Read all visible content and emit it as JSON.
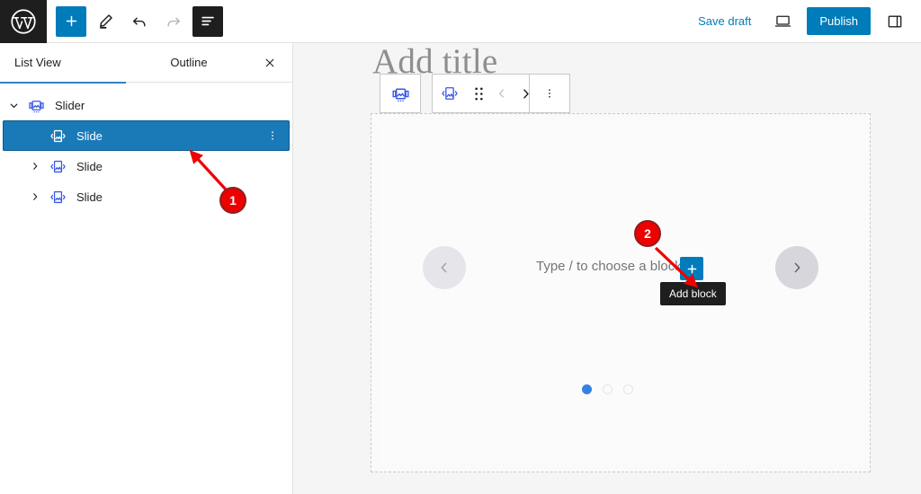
{
  "header": {
    "logo_icon": "wordpress-logo-icon",
    "add_block_icon": "plus-icon",
    "tools_icon": "pencil-edit-icon",
    "undo_icon": "undo-arrow-icon",
    "redo_icon": "redo-arrow-icon",
    "list_view_icon": "list-view-icon",
    "save_draft_label": "Save draft",
    "preview_icon": "desktop-preview-icon",
    "publish_label": "Publish",
    "settings_icon": "sidebar-panel-icon"
  },
  "sidebar": {
    "tabs": [
      {
        "label": "List View",
        "active": true
      },
      {
        "label": "Outline",
        "active": false
      }
    ],
    "close_icon": "close-icon",
    "rows": [
      {
        "label": "Slider",
        "icon": "slider-block-icon",
        "depth": 0,
        "expanded": true,
        "selected": false,
        "has_chevron": true
      },
      {
        "label": "Slide",
        "icon": "slide-block-icon",
        "depth": 1,
        "expanded": false,
        "selected": true,
        "has_chevron": false
      },
      {
        "label": "Slide",
        "icon": "slide-block-icon",
        "depth": 1,
        "expanded": false,
        "selected": false,
        "has_chevron": true
      },
      {
        "label": "Slide",
        "icon": "slide-block-icon",
        "depth": 1,
        "expanded": false,
        "selected": false,
        "has_chevron": true
      }
    ],
    "row_options_icon": "vertical-dots-icon"
  },
  "canvas": {
    "title_placeholder": "Add title",
    "toolbar": {
      "parent_block_icon": "slider-block-icon",
      "block_type_icon": "slide-block-icon",
      "drag_handle_icon": "drag-dots-icon",
      "move_prev_icon": "chevron-left-icon",
      "move_next_icon": "chevron-right-icon",
      "options_icon": "vertical-dots-icon"
    },
    "slider": {
      "prev_arrow_icon": "chevron-left-icon",
      "next_arrow_icon": "chevron-right-icon",
      "placeholder_text": "Type / to choose a block",
      "add_block_icon": "plus-icon",
      "tooltip_label": "Add block",
      "dots": [
        {
          "active": true
        },
        {
          "active": false
        },
        {
          "active": false
        }
      ]
    }
  },
  "annotations": [
    {
      "number": "1",
      "target": "selected-slide-row"
    },
    {
      "number": "2",
      "target": "add-block-button"
    }
  ],
  "colors": {
    "accent_blue": "#007cba",
    "block_icon_blue": "#3858e9",
    "selected_row_blue": "#1a7ab8",
    "annotation_red": "#ee0000",
    "dark": "#1e1e1e"
  }
}
